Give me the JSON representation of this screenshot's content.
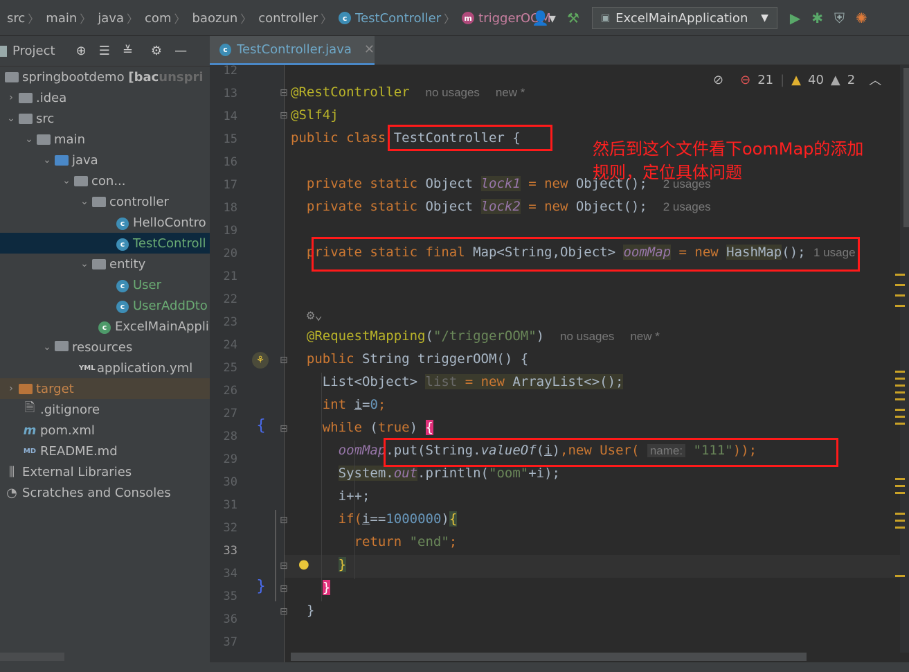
{
  "breadcrumbs": [
    "src",
    "main",
    "java",
    "com",
    "baozun",
    "controller"
  ],
  "breadcrumb_class": "TestController",
  "breadcrumb_method": "triggerOOM",
  "run_config": "ExcelMainApplication",
  "project": {
    "title": "Project",
    "items": [
      {
        "label": "springbootdemo",
        "suffix": "[bac",
        "note": "unspri"
      },
      {
        "label": ".idea"
      },
      {
        "label": "src"
      },
      {
        "label": "main"
      },
      {
        "label": "java"
      },
      {
        "label": "con..."
      },
      {
        "label": "controller"
      },
      {
        "label": "HelloContro"
      },
      {
        "label": "TestControll"
      },
      {
        "label": "entity"
      },
      {
        "label": "User"
      },
      {
        "label": "UserAddDto"
      },
      {
        "label": "ExcelMainAppli"
      },
      {
        "label": "resources"
      },
      {
        "label": "application.yml"
      },
      {
        "label": "target"
      },
      {
        "label": ".gitignore"
      },
      {
        "label": "pom.xml"
      },
      {
        "label": "README.md"
      },
      {
        "label": "External Libraries"
      },
      {
        "label": "Scratches and Consoles"
      }
    ]
  },
  "editor": {
    "tab_label": "TestController.java",
    "inspections": {
      "errors": "21",
      "warnings": "40",
      "weak": "2"
    },
    "line_numbers": [
      "12",
      "13",
      "14",
      "15",
      "16",
      "17",
      "18",
      "19",
      "20",
      "21",
      "22",
      "23",
      "24",
      "25",
      "26",
      "27",
      "28",
      "29",
      "30",
      "31",
      "32",
      "33",
      "34",
      "35",
      "36",
      "37"
    ],
    "hints": {
      "no_usages": "no usages",
      "new_star": "new *",
      "two_usages": "2 usages",
      "one_usage": "1 usage",
      "param_name": "name:"
    },
    "tokens": {
      "rest_controller": "@RestController",
      "slf4j": "@Slf4j",
      "public_class": "public class ",
      "class_name": "TestController {",
      "private_static": "private static ",
      "private_static_final": "private static final ",
      "object_type": "Object ",
      "lock1": "lock1",
      "lock2": "lock2",
      "eq_new": " = new ",
      "object_ctor": "Object();",
      "map_type": "Map<String,Object> ",
      "oom_map": "oomMap",
      "hashmap": "HashMap",
      "paren_semi": "();",
      "request_mapping": "@RequestMapping",
      "mapping_path": "\"/triggerOOM\"",
      "public": "public ",
      "string_type": "String ",
      "method_sig": "triggerOOM() {",
      "list_type": "List<Object> ",
      "list_var": "list",
      "arraylist": "ArrayList<>();",
      "int_kw": "int ",
      "i_var": "i",
      "zero": "0",
      "while_kw": "while ",
      "true_kw": "true",
      "put_call": ".put(String.",
      "value_of": "valueOf",
      "new_user": ",new User(",
      "str_111": "\"111\"",
      "close_call": "));",
      "system": "System.",
      "out": "out",
      "println": ".println(",
      "str_oom": "\"oom\"",
      "plus_i": "+i);",
      "i_inc": "i++;",
      "if_kw": "if(",
      "eq_eq": "==",
      "million": "1000000",
      "return_kw": "return ",
      "str_end": "\"end\"",
      "semi": ";",
      "rbrace": "}"
    }
  },
  "annotation_text": [
    "然后到这个文件看下oomMap的添加",
    "规则，定位具体问题"
  ],
  "colors": {
    "accent": "#4a88c7",
    "highlight_box": "#ff1a1a",
    "keyword": "#cc7832"
  }
}
